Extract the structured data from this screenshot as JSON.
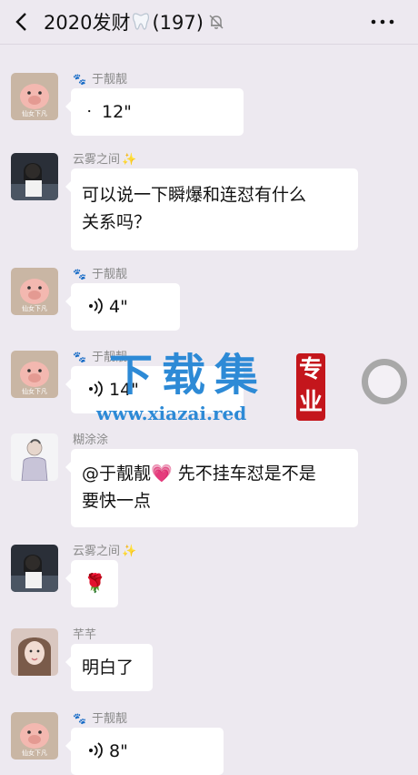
{
  "header": {
    "back_icon": "chevron-left-icon",
    "title": "2020发财",
    "emoji": "tooth-icon",
    "count": "(197)",
    "mute_icon": "muted-bell-icon",
    "more_icon": "more-dots-icon"
  },
  "messages": [
    {
      "nickname": "于靓靓",
      "type": "voice",
      "duration": "12\"",
      "avatar_caption": "仙女下凡"
    },
    {
      "nickname": "云雾之间",
      "type": "text",
      "lines": [
        "可以说一下瞬爆和连怼有什么",
        "关系吗？"
      ]
    },
    {
      "nickname": "于靓靓",
      "type": "voice",
      "duration": "4\"",
      "avatar_caption": "仙女下凡"
    },
    {
      "nickname": "于靓靓",
      "type": "voice",
      "duration": "14\"",
      "avatar_caption": "仙女下凡"
    },
    {
      "nickname": "糊涂涂",
      "type": "text",
      "lines": [
        "@于靓靓💗 先不挂车怼是不是",
        "要快一点"
      ]
    },
    {
      "nickname": "云雾之间",
      "type": "emoji",
      "content": "🌹"
    },
    {
      "nickname": "芊芊",
      "type": "text",
      "lines": [
        "明白了"
      ]
    },
    {
      "nickname": "于靓靓",
      "type": "voice",
      "duration": "8\"",
      "avatar_caption": "仙女下凡"
    }
  ],
  "watermark": {
    "main": "下载集",
    "seal": [
      "专",
      "业"
    ],
    "url": "www.xiazai.red"
  },
  "colors": {
    "background": "#ede9f0",
    "bubble": "#ffffff",
    "nickname": "#8a8a8a",
    "watermark": "#2d8ad6",
    "seal": "#c4161c"
  }
}
